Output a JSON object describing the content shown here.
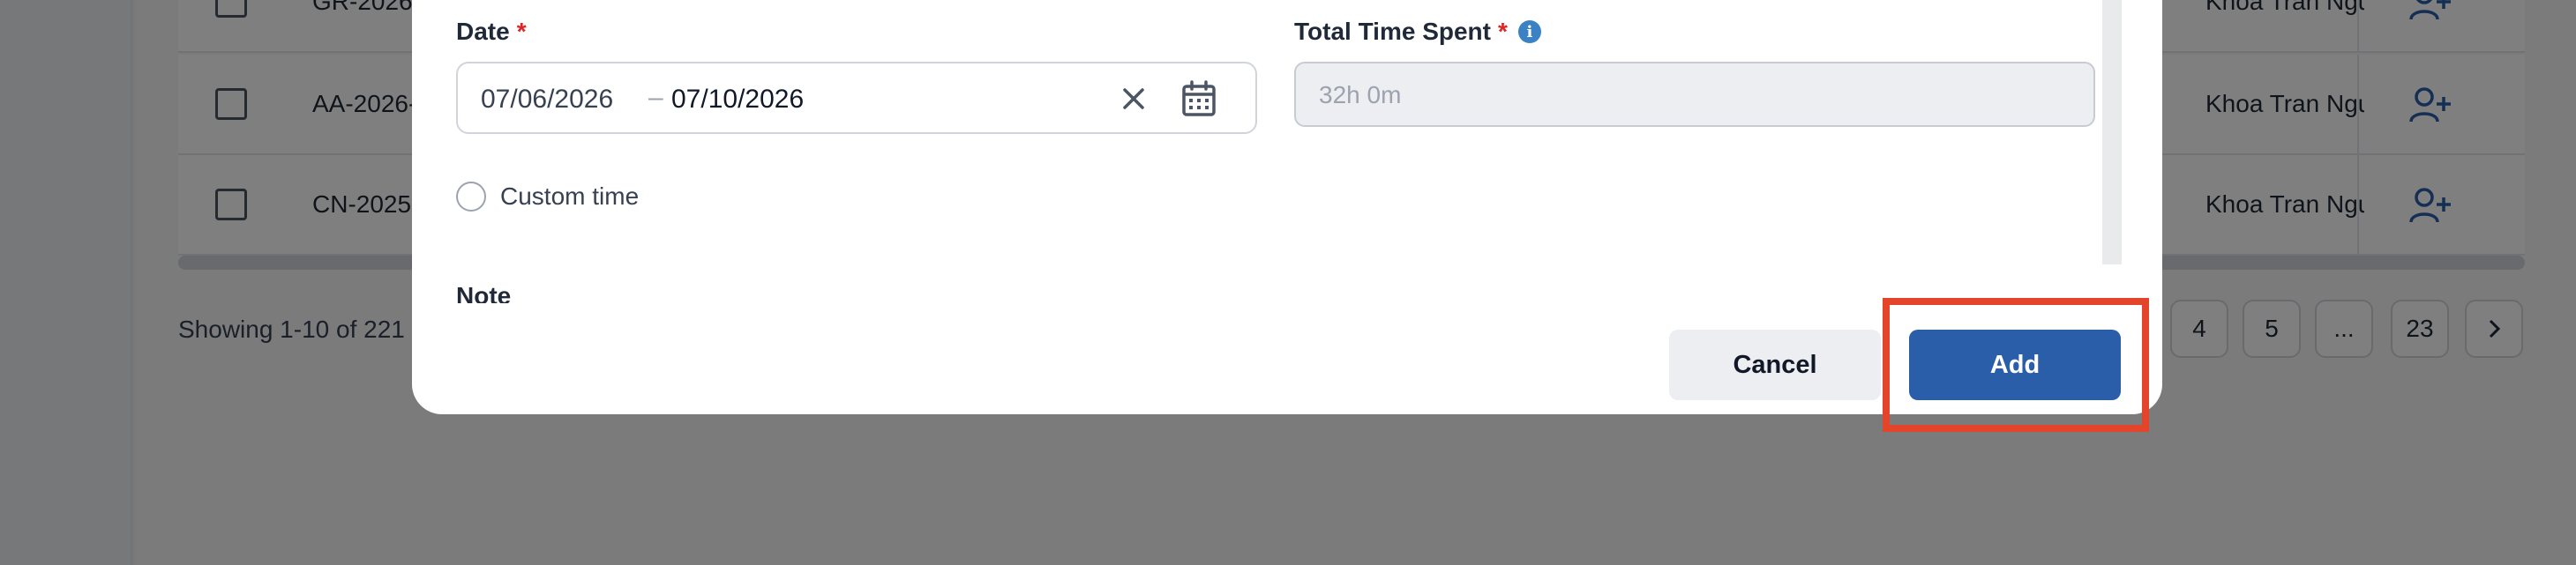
{
  "background": {
    "rows": [
      {
        "code": "GR-2026-",
        "owner": "Khoa Tran Ngu"
      },
      {
        "code": "AA-2026-",
        "owner": "Khoa Tran Ngu"
      },
      {
        "code": "CN-2025-",
        "owner": "Khoa Tran Ngu"
      }
    ],
    "showing_text": "Showing 1-10 of 221",
    "pagination": [
      "4",
      "5",
      "...",
      "23"
    ]
  },
  "modal": {
    "date": {
      "label": "Date",
      "required_mark": "*",
      "start": "07/06/2026",
      "separator": "–",
      "end": "07/10/2026"
    },
    "total_time": {
      "label": "Total Time Spent",
      "required_mark": "*",
      "info_glyph": "i",
      "value": "32h 0m"
    },
    "custom_time_label": "Custom time",
    "note_label": "Note",
    "cancel_label": "Cancel",
    "add_label": "Add"
  },
  "colors": {
    "primary": "#2a5ea8",
    "required": "#dc2626",
    "highlight": "#e4452a",
    "info": "#3b82c4"
  },
  "icons": {
    "clear": "close-icon",
    "calendar": "calendar-icon",
    "info": "info-icon",
    "assign": "user-plus-icon",
    "next": "chevron-right-icon"
  }
}
